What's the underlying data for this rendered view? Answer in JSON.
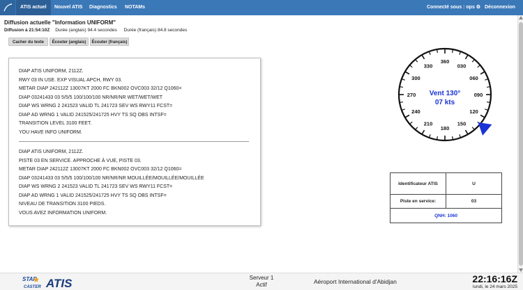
{
  "nav": {
    "tabs": [
      "ATIS actuel",
      "Nouvel ATIS",
      "Diagnostics",
      "NOTAMs"
    ],
    "connected": "Connecté sous : ops",
    "logout": "Déconnexion"
  },
  "page": {
    "title": "Diffusion actuelle \"Information UNIFORM\"",
    "broadcast_label": "Diffusion à 21:54:10Z",
    "duration_en": "Durée (anglais) 94.4 secondes",
    "duration_fr": "Durée (français) 84.8 secondes"
  },
  "buttons": {
    "hide_text": "Cacher du texte",
    "listen_en": "Écouter (anglais)",
    "listen_fr": "Écouter (français)"
  },
  "atis_en": [
    "DIAP ATIS UNIFORM, 2112Z.",
    "RWY 03 IN USE. EXP VISUAL APCH, RWY 03.",
    "METAR DIAP 242112Z 13007KT 2000 FC BKN002 OVC003 32/12 Q1060=",
    "DIAP 03241433 03 5/5/5 100/100/100 NR/NR/NR WET/WET/WET",
    "DIAP WS WRNG 2 241523 VALID TL 241723 SEV WS RWY11 FCST=",
    "DIAP AD WRNG 1 VALID 241525/241725 HVY TS SQ OBS INTSF=",
    "TRANSITION LEVEL 3100 FEET.",
    "YOU HAVE INFO UNIFORM."
  ],
  "atis_fr": [
    "DIAP ATIS UNIFORM, 2112Z.",
    "PISTE 03 EN SERVICE. APPROCHE À VUE, PISTE 03.",
    "METAR DIAP 242112Z 13007KT 2000 FC BKN002 OVC003 32/12 Q1060=",
    "DIAP 03241433 03 5/5/5 100/100/100 NR/NR/NR MOUILLÉE/MOUILLÉE/MOUILLÉE",
    "DIAP WS WRNG 2 241523 VALID TL 241723 SEV WS RWY11 FCST=",
    "DIAP AD WRNG 1 VALID 241525/241725 HVY TS SQ OBS INTSF=",
    "NIVEAU DE TRANSITION 3100 PIEDS.",
    "VOUS AVEZ INFORMATION UNIFORM."
  ],
  "compass": {
    "labels": [
      "360",
      "030",
      "060",
      "090",
      "120",
      "150",
      "180",
      "210",
      "240",
      "270",
      "300",
      "330"
    ],
    "wind_line1": "Vent 130°",
    "wind_line2": "07 kts",
    "wind_direction_deg": 130,
    "accent_color": "#1a33d6"
  },
  "info": {
    "identifier_label": "Identificateur ATIS",
    "identifier_value": "U",
    "runway_label": "Piste en service:",
    "runway_value": "03",
    "qnh": "QNH: 1060"
  },
  "footer": {
    "brand_top": "STAR",
    "brand_bottom": "CASTER",
    "brand_main": "ATIS",
    "server_line1": "Serveur 1",
    "server_line2": "Actif",
    "airport": "Aéroport International d'Abidjan",
    "time": "22:16:16Z",
    "date": "lundi, le 24 mars 2025"
  }
}
